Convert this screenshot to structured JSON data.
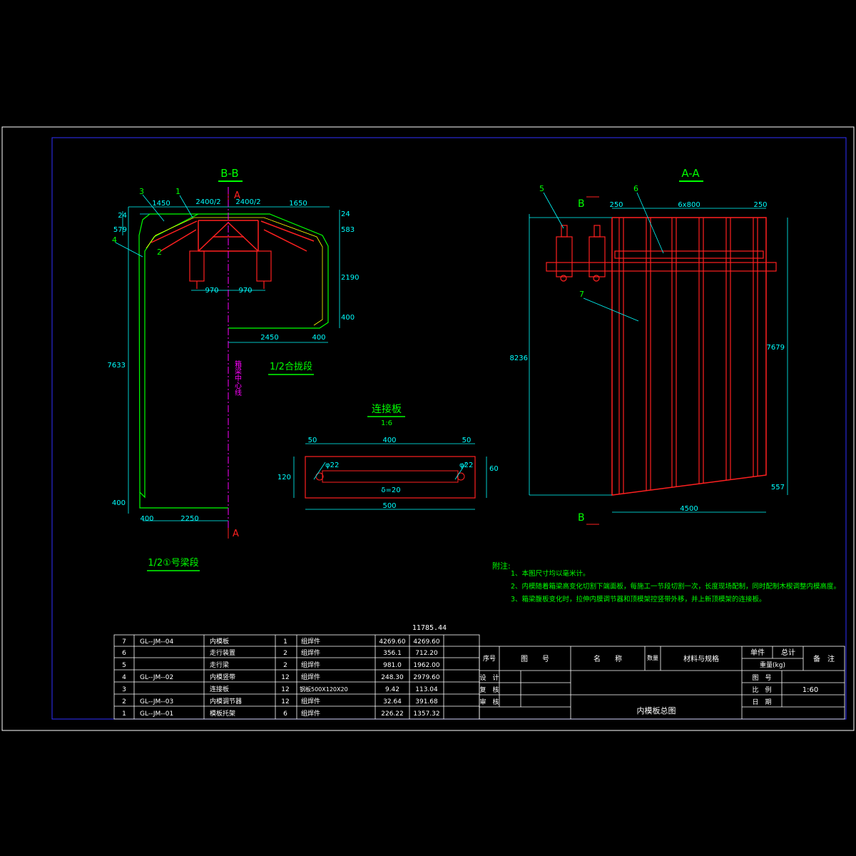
{
  "colors": {
    "background": "#000000",
    "frame": "#ffffff",
    "frame_inner": "#2020ff",
    "title_green": "#00ff00",
    "dimension_cyan": "#00ffff",
    "structure_red": "#ff2020",
    "structure_magenta": "#ff00ff",
    "outline_green": "#00ff00",
    "table_white": "#ffffff",
    "yellow": "#ffff00"
  },
  "views": {
    "bb": {
      "title": "B-B",
      "section_mark": "A",
      "half_label_1": "1/2合拢段",
      "half_label_2": "1/2①号梁段",
      "centerline_label": "箱梁中心线",
      "dims": {
        "top_left": "1450",
        "top_mid_left": "2400/2",
        "top_mid_right": "2400/2",
        "top_right": "1650",
        "right_top": "24",
        "right_583": "583",
        "right_2190": "2190",
        "right_400": "400",
        "left_579": "579",
        "left_24": "24",
        "mid_970_a": "970",
        "mid_970_b": "970",
        "bottom_2450": "2450",
        "bottom_400_r": "400",
        "left_7633": "7633",
        "left_400_b": "400",
        "bottom_400_l": "400",
        "bottom_2250": "2250"
      },
      "callouts": [
        "3",
        "1",
        "2",
        "4"
      ]
    },
    "aa": {
      "title": "A-A",
      "section_mark": "B",
      "dims": {
        "top_250_l": "250",
        "top_span": "6x800",
        "top_250_r": "250",
        "left_8236": "8236",
        "right_7679": "7679",
        "right_557": "557",
        "bottom_4500": "4500"
      },
      "callouts": [
        "5",
        "6",
        "7"
      ]
    },
    "plate": {
      "title": "连接板",
      "scale": "1:6",
      "dims": {
        "top_50_l": "50",
        "top_400": "400",
        "top_50_r": "50",
        "left_120": "120",
        "right_60": "60",
        "bottom_500": "500",
        "hole_l": "φ22",
        "hole_r": "φ22",
        "slot": "δ=20"
      }
    }
  },
  "notes": {
    "heading": "附注:",
    "items": [
      "1、本图尺寸均以毫米计。",
      "2、内模随着箱梁高变化切割下端面板，每施工一节段切割一次，长度现场配制，同时配制木楔调整内模高度。",
      "3、箱梁腹板变化时，拉伸内膜调节器和顶模架控竖带外移，并上新顶模架的连接板。"
    ]
  },
  "bom": {
    "total": "11785.44",
    "rows": [
      {
        "no": "7",
        "code": "GL--JM--04",
        "name": "内模板",
        "qty": "1",
        "mat": "组焊件",
        "unit": "4269.60",
        "sum": "4269.60"
      },
      {
        "no": "6",
        "code": "",
        "name": "走行装置",
        "qty": "2",
        "mat": "组焊件",
        "unit": "356.1",
        "sum": "712.20"
      },
      {
        "no": "5",
        "code": "",
        "name": "走行梁",
        "qty": "2",
        "mat": "组焊件",
        "unit": "981.0",
        "sum": "1962.00"
      },
      {
        "no": "4",
        "code": "GL--JM--02",
        "name": "内模竖带",
        "qty": "12",
        "mat": "组焊件",
        "unit": "248.30",
        "sum": "2979.60"
      },
      {
        "no": "3",
        "code": "",
        "name": "连接板",
        "qty": "12",
        "mat": "钢板500X120X20",
        "unit": "9.42",
        "sum": "113.04"
      },
      {
        "no": "2",
        "code": "GL--JM--03",
        "name": "内模调节器",
        "qty": "12",
        "mat": "组焊件",
        "unit": "32.64",
        "sum": "391.68"
      },
      {
        "no": "1",
        "code": "GL--JM--01",
        "name": "模板托架",
        "qty": "6",
        "mat": "组焊件",
        "unit": "226.22",
        "sum": "1357.32"
      }
    ],
    "header": {
      "no": "序号",
      "code": "图　　号",
      "name": "名　　称",
      "qty": "数量",
      "mat": "材料与规格",
      "unit": "单件",
      "sum": "总计",
      "weight": "重量(kg)",
      "remark": "备　注"
    }
  },
  "title_block": {
    "design": "设　计",
    "review": "复　核",
    "approve": "审　核",
    "drawing_no": "图　号",
    "scale_label": "比　例",
    "scale_value": "1:60",
    "date": "日　期",
    "drawing_title": "内模板总图"
  }
}
